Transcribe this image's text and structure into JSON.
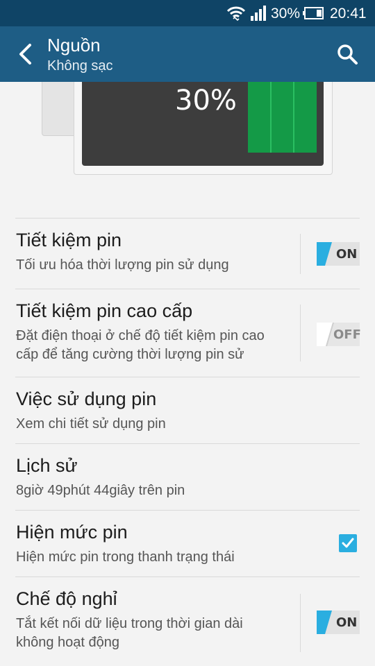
{
  "status_bar": {
    "battery_percent": "30%",
    "time": "20:41",
    "icons": [
      "wifi-icon",
      "signal-icon",
      "battery-icon"
    ]
  },
  "app_bar": {
    "title": "Nguồn",
    "subtitle": "Không sạc",
    "back_icon": "back-arrow-icon",
    "search_icon": "search-icon"
  },
  "battery_graphic": {
    "percent_label": "30%",
    "level": 0.3,
    "level_color": "#149a47"
  },
  "settings": [
    {
      "title": "Tiết kiệm pin",
      "description": "Tối ưu hóa thời lượng pin sử dụng",
      "control": "toggle",
      "state": "ON"
    },
    {
      "title": "Tiết kiệm pin cao cấp",
      "description_lines": [
        "Đặt điện thoại ở chế độ tiết kiệm pin cao",
        "cấp để tăng cường thời lượng pin sử"
      ],
      "control": "toggle",
      "state": "OFF"
    },
    {
      "title": "Việc sử dụng pin",
      "description": "Xem chi tiết sử dụng pin"
    },
    {
      "title": "Lịch sử",
      "description": "8giờ 49phút 44giây trên pin"
    },
    {
      "title": "Hiện mức pin",
      "description": "Hiện mức pin trong thanh trạng thái",
      "control": "checkbox",
      "checked": true
    },
    {
      "title": "Chế độ nghỉ",
      "description_lines": [
        "Tắt kết nối dữ liệu trong thời gian dài",
        "không hoạt động"
      ],
      "control": "toggle",
      "state": "ON"
    }
  ],
  "colors": {
    "status_bar": "#0f4466",
    "app_bar": "#1e5d85",
    "accent": "#2aaee0",
    "battery_green": "#149a47"
  }
}
